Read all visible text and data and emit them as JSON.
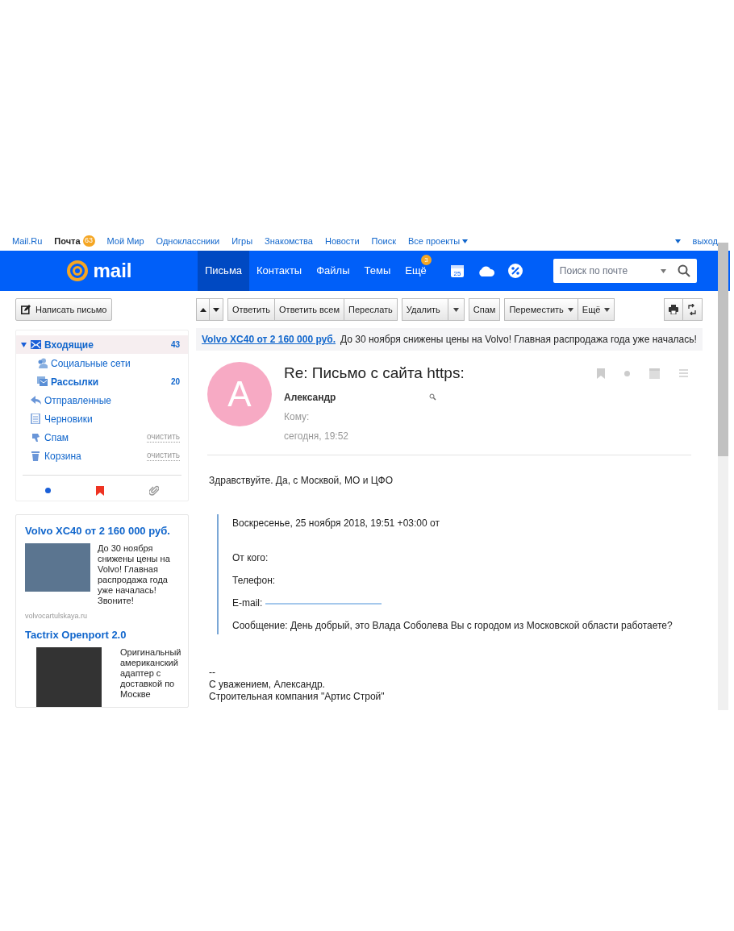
{
  "portal_bar": {
    "links": [
      {
        "label": "Mail.Ru",
        "bold": false
      },
      {
        "label": "Почта",
        "bold": true,
        "badge": "63"
      },
      {
        "label": "Мой Мир",
        "bold": false
      },
      {
        "label": "Одноклассники",
        "bold": false
      },
      {
        "label": "Игры",
        "bold": false
      },
      {
        "label": "Знакомства",
        "bold": false
      },
      {
        "label": "Новости",
        "bold": false
      },
      {
        "label": "Поиск",
        "bold": false
      },
      {
        "label": "Все проекты",
        "bold": false,
        "caret": true
      }
    ],
    "logout": "выход"
  },
  "header": {
    "logo": "mail",
    "tabs": [
      {
        "label": "Письма",
        "selected": true
      },
      {
        "label": "Контакты",
        "selected": false
      },
      {
        "label": "Файлы",
        "selected": false
      },
      {
        "label": "Темы",
        "selected": false
      },
      {
        "label": "Ещё",
        "selected": false,
        "badge": "3"
      }
    ],
    "calendar_day": "25",
    "search": {
      "placeholder": "Поиск по почте"
    }
  },
  "compose_button": "Написать письмо",
  "folders": [
    {
      "name": "Входящие",
      "kind": "inbox",
      "count": "43",
      "bold": true,
      "selected": true,
      "expanded": true,
      "children": [
        {
          "name": "Социальные сети",
          "kind": "social",
          "bold": false,
          "selected": false
        },
        {
          "name": "Рассылки",
          "kind": "newsletters",
          "count": "20",
          "bold": true,
          "selected": false
        }
      ]
    },
    {
      "name": "Отправленные",
      "kind": "sent",
      "bold": false,
      "selected": false
    },
    {
      "name": "Черновики",
      "kind": "drafts",
      "bold": false,
      "selected": false
    },
    {
      "name": "Спам",
      "kind": "spam",
      "bold": false,
      "selected": false,
      "action": "очистить"
    },
    {
      "name": "Корзина",
      "kind": "trash",
      "bold": false,
      "selected": false,
      "action": "очистить"
    }
  ],
  "ads": [
    {
      "title": "Volvo XC40 от 2 160 000 руб.",
      "text": "До 30 ноября снижены цены на Volvo! Главная распродажа года уже началась! Звоните!",
      "domain": "volvocartulskaya.ru"
    },
    {
      "title": "Tactrix Openport 2.0",
      "text": "Оригинальный американский адаптер с доставкой по Москве"
    }
  ],
  "toolbar": [
    [
      {
        "label": "Ответить",
        "caret": false,
        "split": false
      },
      {
        "label": "Ответить всем",
        "caret": false,
        "split": false
      },
      {
        "label": "Переслать",
        "caret": false,
        "split": false
      }
    ],
    [
      {
        "label": "Удалить",
        "caret": false,
        "split": true
      }
    ],
    [
      {
        "label": "Спам",
        "caret": false,
        "split": false
      }
    ],
    [
      {
        "label": "Переместить",
        "caret": true,
        "split": false
      },
      {
        "label": "Ещё",
        "caret": true,
        "split": false
      }
    ]
  ],
  "banner": {
    "link": "Volvo XC40 от 2 160 000 руб.",
    "text": "До 30 ноября снижены цены на Volvo! Главная распродажа года уже началась!"
  },
  "message": {
    "avatar_letter": "A",
    "subject": "Re: Письмо с сайта https:",
    "sender": "Александр",
    "to_label": "Кому:",
    "date": "сегодня, 19:52",
    "body": [
      "Здравствуйте. Да, с Москвой, МО и ЦФО"
    ],
    "quote": {
      "header": "Воскресенье, 25 ноября 2018, 19:51 +03:00 от",
      "lines": [
        "От кого:",
        "Телефон:",
        "E-mail:",
        "Сообщение: День добрый, это Влада Соболева Вы с городом из Московской области работаете?"
      ]
    },
    "signature": [
      "--",
      "С уважением, Александр.",
      "Строительная компания \"Артис Строй\""
    ]
  }
}
